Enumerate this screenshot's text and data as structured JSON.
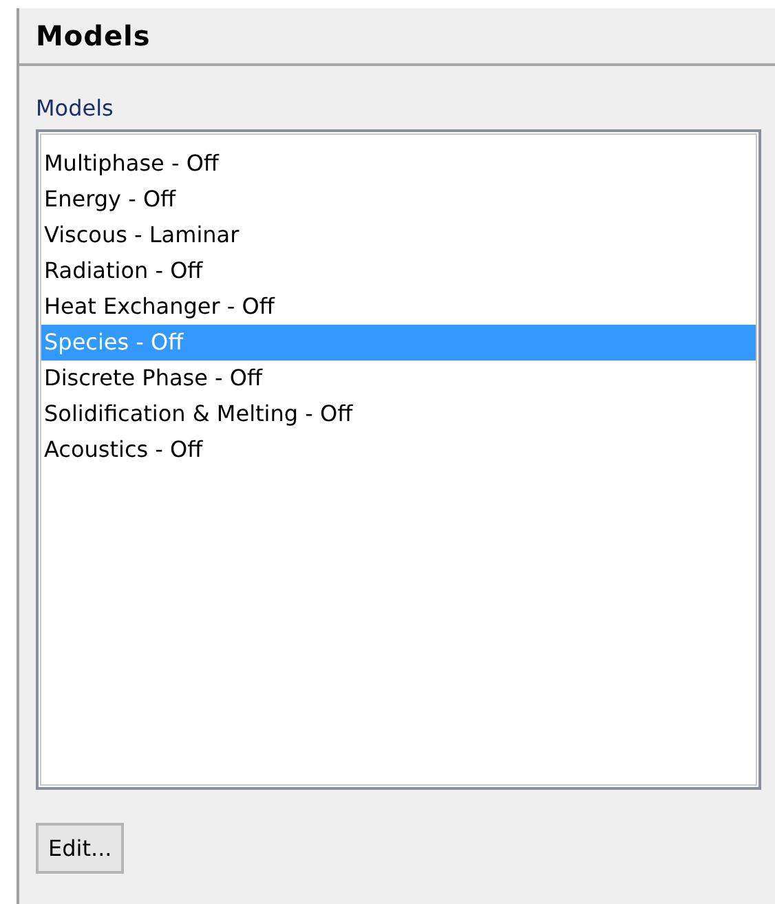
{
  "panel": {
    "title": "Models"
  },
  "list": {
    "label": "Models",
    "items": [
      {
        "text": "Multiphase - Off",
        "selected": false
      },
      {
        "text": "Energy - Off",
        "selected": false
      },
      {
        "text": "Viscous - Laminar",
        "selected": false
      },
      {
        "text": "Radiation - Off",
        "selected": false
      },
      {
        "text": "Heat Exchanger - Off",
        "selected": false
      },
      {
        "text": "Species - Off",
        "selected": true
      },
      {
        "text": "Discrete Phase - Off",
        "selected": false
      },
      {
        "text": "Solidification & Melting - Off",
        "selected": false
      },
      {
        "text": "Acoustics - Off",
        "selected": false
      }
    ]
  },
  "buttons": [
    "Edit..."
  ]
}
